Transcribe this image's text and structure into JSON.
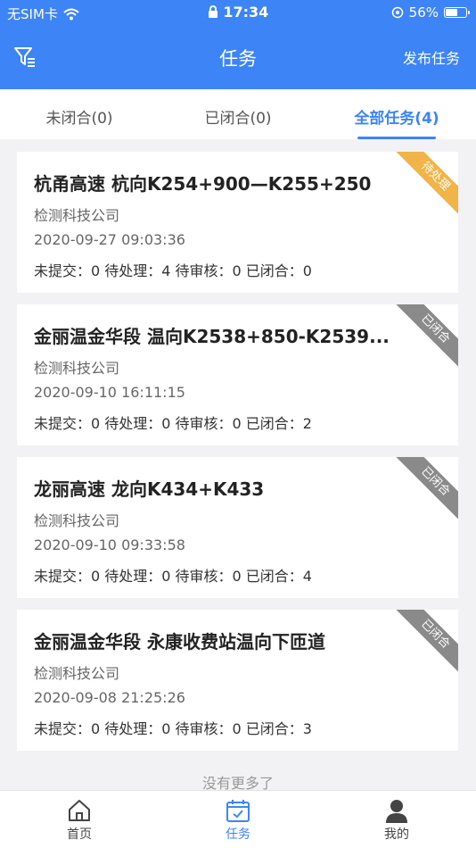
{
  "status": {
    "carrier": "无SIM卡",
    "time": "17:34",
    "battery": "56%",
    "battery_level": 0.56
  },
  "nav": {
    "title": "任务",
    "publish_label": "发布任务"
  },
  "tabs": [
    {
      "label": "未闭合(0)",
      "active": false
    },
    {
      "label": "已闭合(0)",
      "active": false
    },
    {
      "label": "全部任务(4)",
      "active": true
    }
  ],
  "colors": {
    "primary": "#3d84f6",
    "pending": "#f0b448",
    "closed": "#8a8a8a"
  },
  "tasks": [
    {
      "title": "杭甬高速 杭向K254+900—K255+250",
      "company": "检测科技公司",
      "date": "2020-09-27 09:03:36",
      "stats": "未提交：0 待处理：4 待审核：0 已闭合：0",
      "badge": "待处理",
      "badge_color": "#f0b448"
    },
    {
      "title": "金丽温金华段 温向K2538+850-K2539...",
      "company": "检测科技公司",
      "date": "2020-09-10 16:11:15",
      "stats": "未提交：0 待处理：0 待审核：0 已闭合：2",
      "badge": "已闭合",
      "badge_color": "#8a8a8a"
    },
    {
      "title": "龙丽高速 龙向K434+K433",
      "company": "检测科技公司",
      "date": "2020-09-10 09:33:58",
      "stats": "未提交：0 待处理：0 待审核：0 已闭合：4",
      "badge": "已闭合",
      "badge_color": "#8a8a8a"
    },
    {
      "title": "金丽温金华段 永康收费站温向下匝道",
      "company": "检测科技公司",
      "date": "2020-09-08 21:25:26",
      "stats": "未提交：0 待处理：0 待审核：0 已闭合：3",
      "badge": "已闭合",
      "badge_color": "#8a8a8a"
    }
  ],
  "footer_text": "没有更多了",
  "tabbar": [
    {
      "label": "首页",
      "icon": "home-icon",
      "active": false
    },
    {
      "label": "任务",
      "icon": "task-calendar-icon",
      "active": true
    },
    {
      "label": "我的",
      "icon": "user-icon",
      "active": false
    }
  ]
}
